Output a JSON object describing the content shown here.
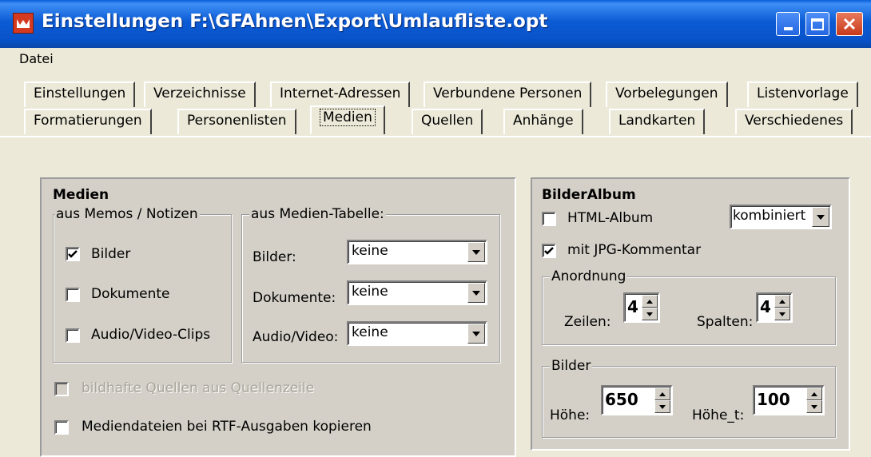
{
  "window": {
    "title": "Einstellungen  F:\\GFAhnen\\Export\\Umlaufliste.opt",
    "colors": {
      "titlebar": "#0b5bd5",
      "close": "#c7391a",
      "face": "#d4d0c8"
    }
  },
  "menu": {
    "datei": "Datei"
  },
  "tabs_row1": [
    "Einstellungen",
    "Verzeichnisse",
    "Internet-Adressen",
    "Verbundene Personen",
    "Vorbelegungen",
    "Listenvorlage"
  ],
  "tabs_row2": [
    "Formatierungen",
    "Personenlisten",
    "Medien",
    "Quellen",
    "Anhänge",
    "Landkarten",
    "Verschiedenes"
  ],
  "selected_tab": "Medien",
  "medien": {
    "heading": "Medien",
    "memos_group": "aus Memos / Notizen",
    "memo_items": [
      {
        "label": "Bilder",
        "checked": true
      },
      {
        "label": "Dokumente",
        "checked": false
      },
      {
        "label": "Audio/Video-Clips",
        "checked": false
      }
    ],
    "table_group": "aus Medien-Tabelle:",
    "table_rows": [
      {
        "label": "Bilder:",
        "value": "keine"
      },
      {
        "label": "Dokumente:",
        "value": "keine"
      },
      {
        "label": "Audio/Video:",
        "value": "keine"
      }
    ],
    "bildhafte": {
      "label": "bildhafte Quellen aus Quellenzeile",
      "checked": false,
      "disabled": true
    },
    "rtf": {
      "label": "Mediendateien bei RTF-Ausgaben kopieren",
      "checked": false
    }
  },
  "album": {
    "heading": "BilderAlbum",
    "html_album": {
      "label": "HTML-Album",
      "checked": false
    },
    "mode": "kombiniert",
    "jpg": {
      "label": "mit JPG-Kommentar",
      "checked": true
    },
    "anordnung": "Anordnung",
    "zeilen_label": "Zeilen:",
    "zeilen": "4",
    "spalten_label": "Spalten:",
    "spalten": "4",
    "bilder_group": "Bilder",
    "hoehe_label": "Höhe:",
    "hoehe": "650",
    "hoehe_t_label": "Höhe_t:",
    "hoehe_t": "100"
  }
}
